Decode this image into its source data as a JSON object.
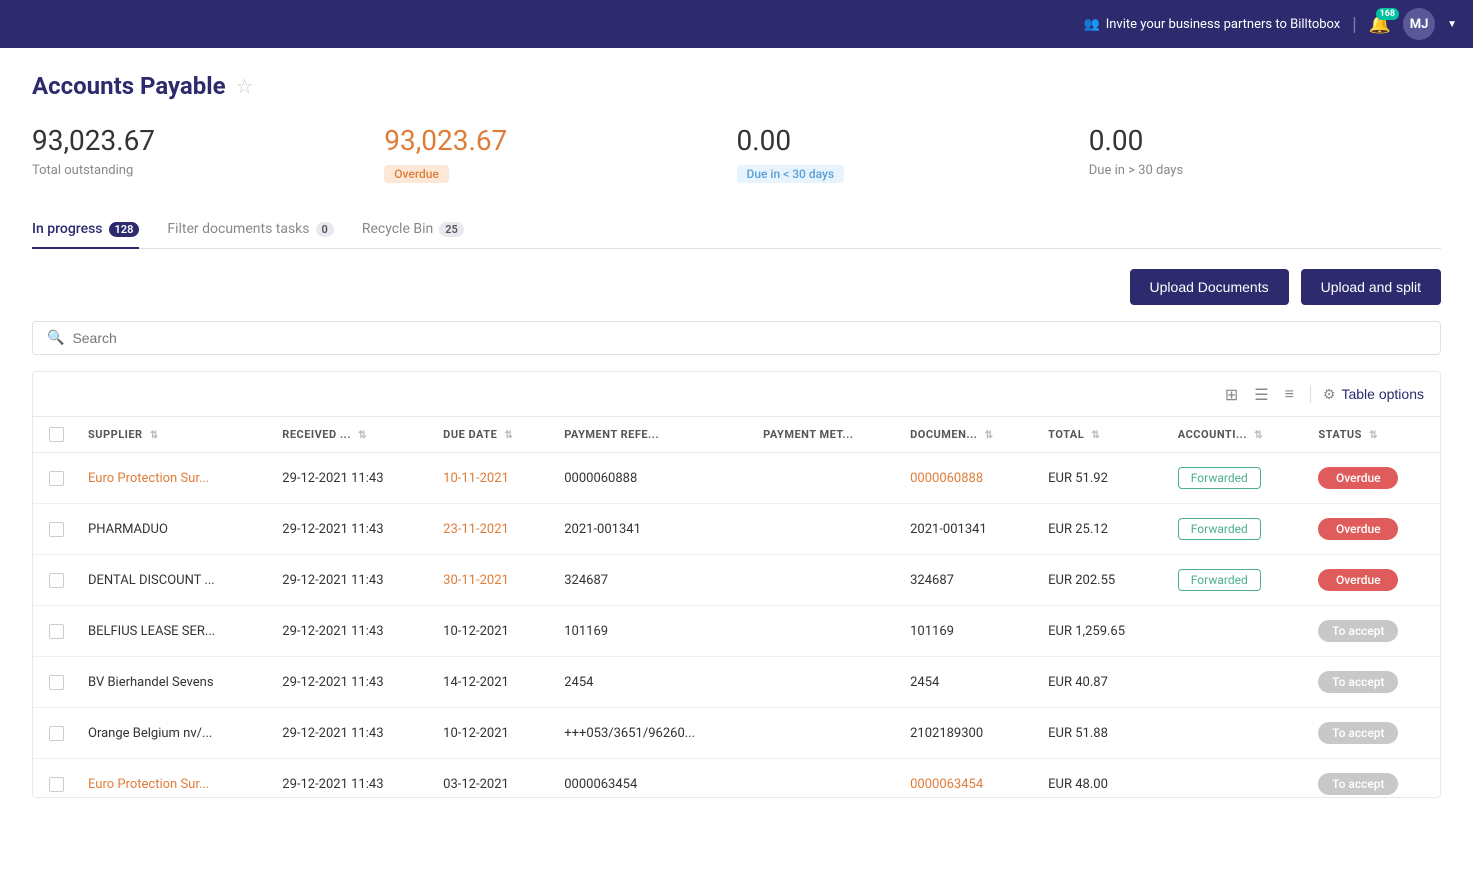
{
  "topnav": {
    "invite_text": "Invite your business partners to Billtobox",
    "notification_count": "168",
    "avatar_initials": "MJ"
  },
  "page": {
    "title": "Accounts Payable"
  },
  "stats": [
    {
      "value": "93,023.67",
      "label": "Total outstanding",
      "badge": null,
      "orange": false
    },
    {
      "value": "93,023.67",
      "label": null,
      "badge": "Overdue",
      "badge_type": "overdue",
      "orange": true
    },
    {
      "value": "0.00",
      "label": null,
      "badge": "Due in < 30 days",
      "badge_type": "due-soon",
      "orange": false
    },
    {
      "value": "0.00",
      "label": "Due in > 30 days",
      "badge": null,
      "orange": false
    }
  ],
  "tabs": [
    {
      "label": "In progress",
      "count": "128",
      "active": true
    },
    {
      "label": "Filter documents tasks",
      "count": "0",
      "active": false
    },
    {
      "label": "Recycle Bin",
      "count": "25",
      "active": false
    }
  ],
  "buttons": {
    "upload_documents": "Upload Documents",
    "upload_and_split": "Upload and split"
  },
  "search": {
    "placeholder": "Search"
  },
  "table_toolbar": {
    "table_options": "Table options"
  },
  "table": {
    "columns": [
      {
        "key": "supplier",
        "label": "SUPPLIER"
      },
      {
        "key": "received",
        "label": "RECEIVED ..."
      },
      {
        "key": "due_date",
        "label": "DUE DATE"
      },
      {
        "key": "payment_ref",
        "label": "PAYMENT REFE..."
      },
      {
        "key": "payment_met",
        "label": "PAYMENT MET..."
      },
      {
        "key": "document",
        "label": "DOCUMEN..."
      },
      {
        "key": "total",
        "label": "TOTAL"
      },
      {
        "key": "accounting",
        "label": "ACCOUNTI..."
      },
      {
        "key": "status",
        "label": "STATUS"
      }
    ],
    "rows": [
      {
        "supplier": "Euro Protection Sur...",
        "received": "29-12-2021 11:43",
        "due_date": "10-11-2021",
        "payment_ref": "0000060888",
        "payment_met": "",
        "document": "0000060888",
        "total": "EUR 51.92",
        "accounting": "Forwarded",
        "status": "Overdue",
        "status_type": "overdue",
        "supplier_link": true,
        "doc_link": true
      },
      {
        "supplier": "PHARMADUO",
        "received": "29-12-2021 11:43",
        "due_date": "23-11-2021",
        "payment_ref": "2021-001341",
        "payment_met": "",
        "document": "2021-001341",
        "total": "EUR 25.12",
        "accounting": "Forwarded",
        "status": "Overdue",
        "status_type": "overdue",
        "supplier_link": false,
        "doc_link": false
      },
      {
        "supplier": "DENTAL DISCOUNT ...",
        "received": "29-12-2021 11:43",
        "due_date": "30-11-2021",
        "payment_ref": "324687",
        "payment_met": "",
        "document": "324687",
        "total": "EUR 202.55",
        "accounting": "Forwarded",
        "status": "Overdue",
        "status_type": "overdue",
        "supplier_link": false,
        "doc_link": false
      },
      {
        "supplier": "BELFIUS LEASE SER...",
        "received": "29-12-2021 11:43",
        "due_date": "10-12-2021",
        "payment_ref": "101169",
        "payment_met": "",
        "document": "101169",
        "total": "EUR 1,259.65",
        "accounting": "",
        "status": "To accept",
        "status_type": "to-accept",
        "supplier_link": false,
        "doc_link": false
      },
      {
        "supplier": "BV Bierhandel Sevens",
        "received": "29-12-2021 11:43",
        "due_date": "14-12-2021",
        "payment_ref": "2454",
        "payment_met": "",
        "document": "2454",
        "total": "EUR 40.87",
        "accounting": "",
        "status": "To accept",
        "status_type": "to-accept",
        "supplier_link": false,
        "doc_link": false
      },
      {
        "supplier": "Orange Belgium nv/...",
        "received": "29-12-2021 11:43",
        "due_date": "10-12-2021",
        "payment_ref": "+++053/3651/96260...",
        "payment_met": "",
        "document": "2102189300",
        "total": "EUR 51.88",
        "accounting": "",
        "status": "To accept",
        "status_type": "to-accept",
        "supplier_link": false,
        "doc_link": false
      },
      {
        "supplier": "Euro Protection Sur...",
        "received": "29-12-2021 11:43",
        "due_date": "03-12-2021",
        "payment_ref": "0000063454",
        "payment_met": "",
        "document": "0000063454",
        "total": "EUR 48.00",
        "accounting": "",
        "status": "To accept",
        "status_type": "to-accept",
        "supplier_link": true,
        "doc_link": true
      }
    ]
  }
}
